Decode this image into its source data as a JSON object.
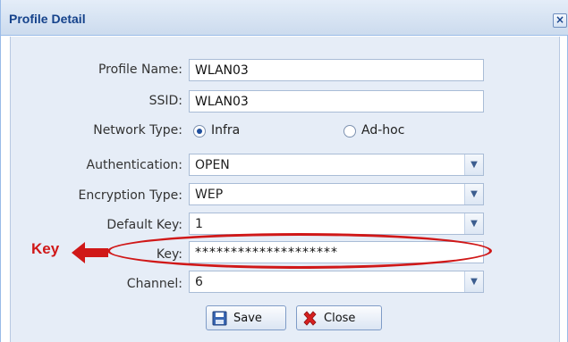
{
  "window": {
    "title": "Profile Detail",
    "close_glyph": "×"
  },
  "form": {
    "profile_name": {
      "label": "Profile Name:",
      "value": "WLAN03"
    },
    "ssid": {
      "label": "SSID:",
      "value": "WLAN03"
    },
    "network_type": {
      "label": "Network Type:",
      "options": [
        {
          "label": "Infra",
          "checked": true
        },
        {
          "label": "Ad-hoc",
          "checked": false
        }
      ]
    },
    "authentication": {
      "label": "Authentication:",
      "value": "OPEN"
    },
    "encryption_type": {
      "label": "Encryption Type:",
      "value": "WEP"
    },
    "default_key": {
      "label": "Default Key:",
      "value": "1"
    },
    "key": {
      "label": "Key:",
      "value": "********************"
    },
    "channel": {
      "label": "Channel:",
      "value": "6"
    }
  },
  "annotation": {
    "text": "Key",
    "color": "#d01818"
  },
  "buttons": {
    "save": "Save",
    "close": "Close"
  },
  "colors": {
    "title": "#15428b",
    "panel": "#e6edf7",
    "accent_red": "#d01818"
  },
  "icons": {
    "save": "floppy-disk-icon",
    "close": "red-x-icon",
    "combo": "chevron-down-icon"
  }
}
